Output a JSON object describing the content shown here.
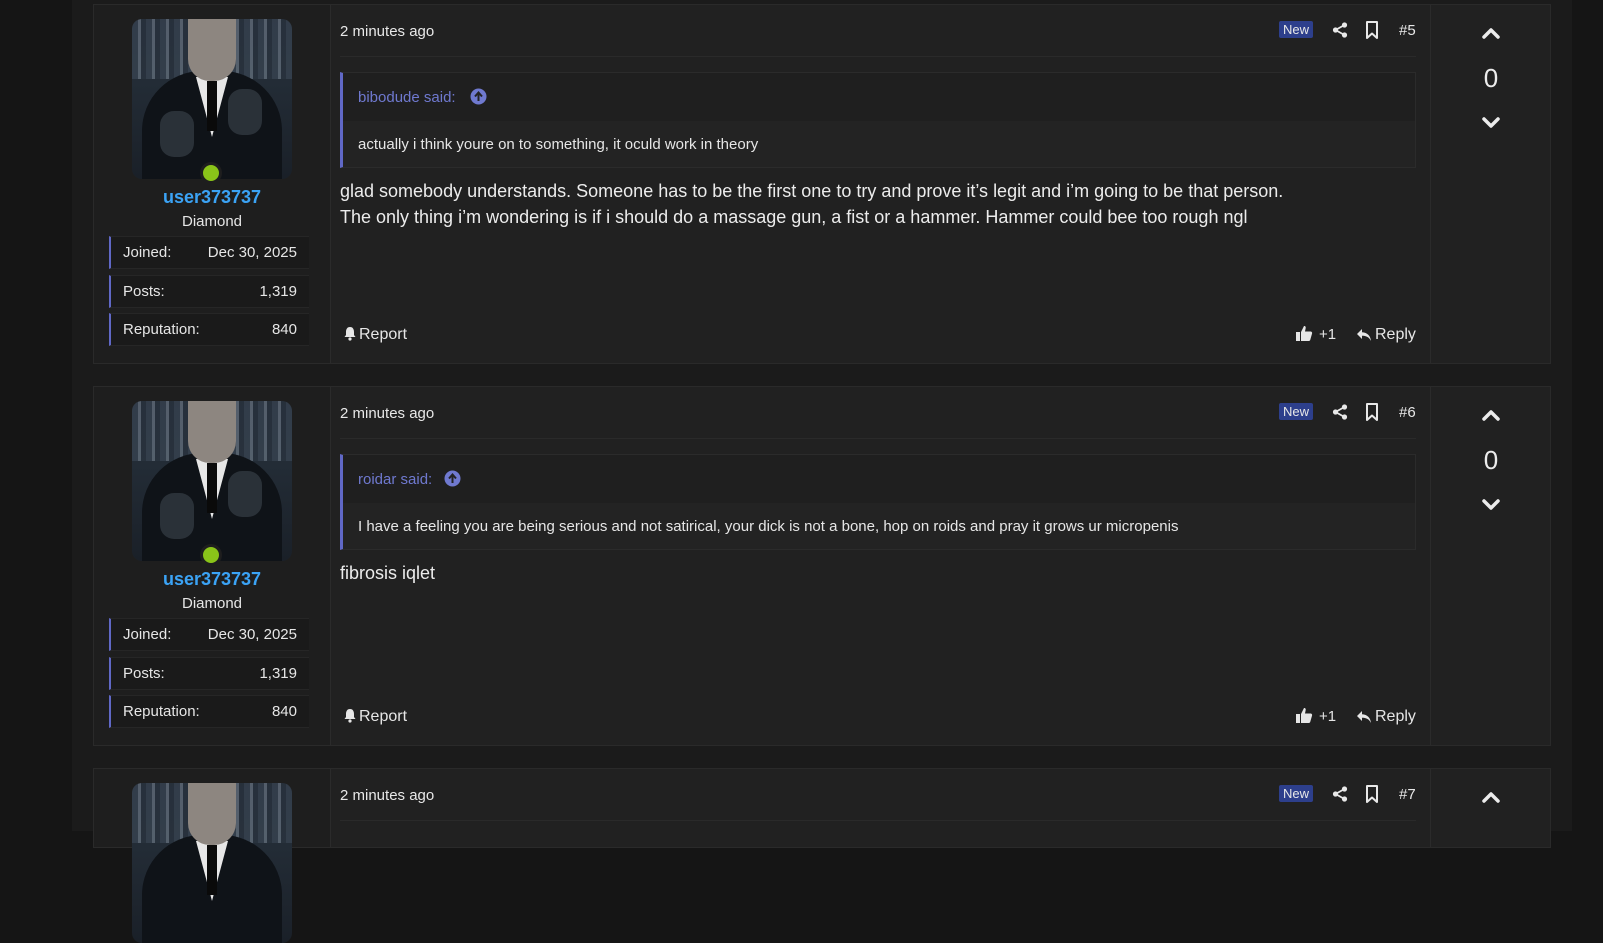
{
  "posts": [
    {
      "user": {
        "name": "user373737",
        "rank": "Diamond",
        "online": true
      },
      "stats": [
        {
          "label": "Joined:",
          "value": "Dec 30, 2025"
        },
        {
          "label": "Posts:",
          "value": "1,319"
        },
        {
          "label": "Reputation:",
          "value": "840"
        }
      ],
      "time": "2 minutes ago",
      "badge": "New",
      "number": "#5",
      "quote": {
        "author": "bibodude said:",
        "text": "actually i think youre on to something, it oculd work in theory"
      },
      "body": [
        "glad somebody understands. Someone has to be the first one to try and prove it’s legit and i’m going to be that person.",
        "The only thing i’m wondering is if i should do a massage gun, a fist or a hammer. Hammer could bee too rough ngl"
      ],
      "report_label": "Report",
      "like_count": "+1",
      "reply_label": "Reply",
      "votes": "0"
    },
    {
      "user": {
        "name": "user373737",
        "rank": "Diamond",
        "online": true
      },
      "stats": [
        {
          "label": "Joined:",
          "value": "Dec 30, 2025"
        },
        {
          "label": "Posts:",
          "value": "1,319"
        },
        {
          "label": "Reputation:",
          "value": "840"
        }
      ],
      "time": "2 minutes ago",
      "badge": "New",
      "number": "#6",
      "quote": {
        "author": "roidar said:",
        "text": "I have a feeling you are being serious and not satirical, your dick is not a bone, hop on roids and pray it grows ur micropenis"
      },
      "body": [
        "fibrosis iqlet"
      ],
      "report_label": "Report",
      "like_count": "+1",
      "reply_label": "Reply",
      "votes": "0"
    },
    {
      "time": "2 minutes ago",
      "badge": "New",
      "number": "#7"
    }
  ],
  "icons": {
    "share": "share-icon",
    "bookmark": "bookmark-icon",
    "vote_up": "chevron-up-icon",
    "vote_down": "chevron-down-icon",
    "report": "bell-icon",
    "like": "thumbs-up-icon",
    "reply": "reply-icon",
    "quote_up": "arrow-circle-up-icon"
  },
  "colors": {
    "username": "#3ba3f5",
    "quote_author": "#6f79cf",
    "badge_bg": "#2d3f8c",
    "online": "#8ac419",
    "accent_border": "#6068c6"
  }
}
